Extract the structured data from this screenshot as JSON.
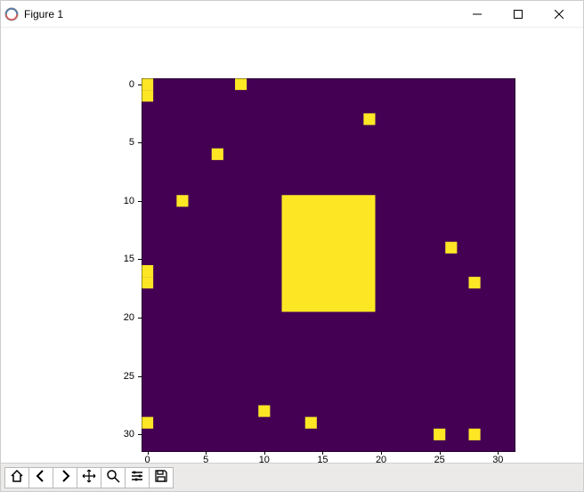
{
  "window": {
    "title": "Figure 1",
    "controls": {
      "minimize": "minimize",
      "maximize": "maximize",
      "close": "close"
    }
  },
  "toolbar": {
    "home": "home-icon",
    "back": "back-icon",
    "forward": "forward-icon",
    "pan": "pan-icon",
    "zoom": "zoom-icon",
    "configure": "configure-icon",
    "save": "save-icon"
  },
  "chart_data": {
    "type": "heatmap",
    "background_value": 0,
    "foreground_value": 1,
    "colors": {
      "0": "#440154",
      "1": "#fde725"
    },
    "xlim": [
      -0.5,
      31.5
    ],
    "ylim": [
      31.5,
      -0.5
    ],
    "grid_shape": [
      32,
      32
    ],
    "x_ticks": [
      0,
      5,
      10,
      15,
      20,
      25,
      30
    ],
    "y_ticks": [
      0,
      5,
      10,
      15,
      20,
      25,
      30
    ],
    "y_tick_labels": [
      "0",
      "5",
      "10",
      "15",
      "20",
      "25",
      "30"
    ],
    "x_tick_labels": [
      "0",
      "5",
      "10",
      "15",
      "20",
      "25",
      "30"
    ],
    "cells_on": [
      [
        0,
        0
      ],
      [
        1,
        0
      ],
      [
        0,
        8
      ],
      [
        3,
        19
      ],
      [
        6,
        6
      ],
      [
        10,
        3
      ],
      [
        14,
        26
      ],
      [
        16,
        0
      ],
      [
        17,
        0
      ],
      [
        17,
        28
      ],
      [
        28,
        10
      ],
      [
        29,
        0
      ],
      [
        29,
        14
      ],
      [
        30,
        25
      ],
      [
        30,
        28
      ]
    ],
    "blocks": [
      {
        "row0": 10,
        "col0": 12,
        "rows": 10,
        "cols": 8
      }
    ],
    "title": "",
    "xlabel": "",
    "ylabel": ""
  }
}
